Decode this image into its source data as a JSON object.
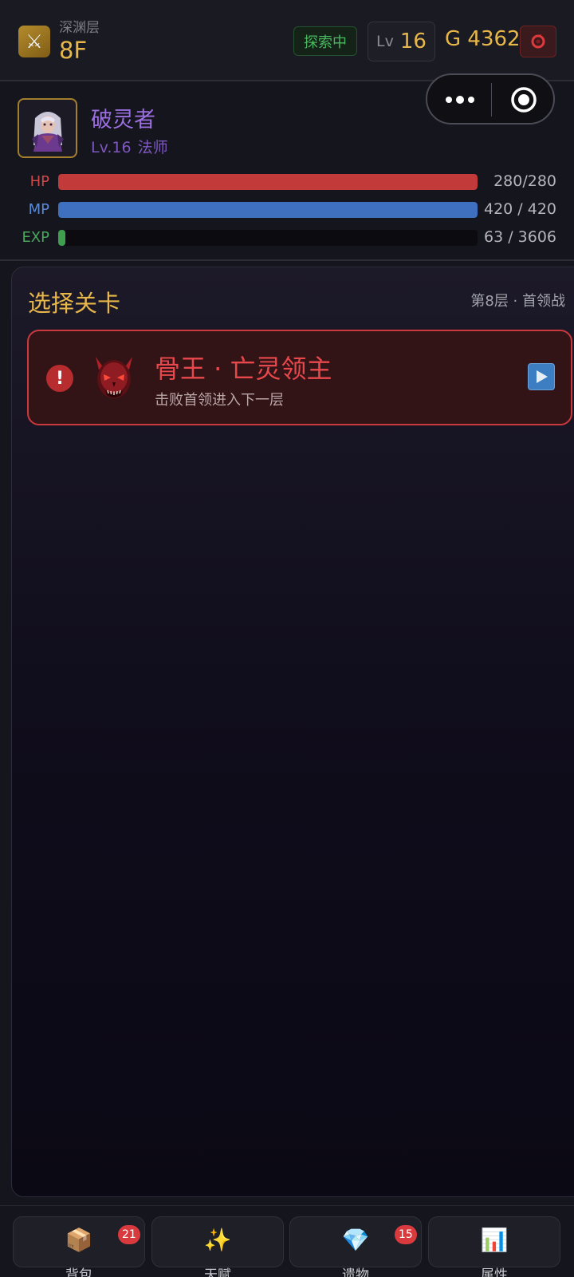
{
  "header": {
    "floor_label": "深渊层",
    "floor_value": "8F",
    "floor_icon": "crossed-swords-icon",
    "status": "探索中",
    "level_prefix": "Lv",
    "level": "16",
    "gold": "G 4362",
    "menu_icon": "red-swirl-icon"
  },
  "capsule": {
    "more_icon": "more-dots-icon",
    "close_icon": "target-circle-icon"
  },
  "player": {
    "name": "破灵者",
    "level_text": "Lv.16",
    "class_text": "法师",
    "name_color": "#9b6fe0",
    "stats": [
      {
        "label": "HP",
        "value": "280/280",
        "fill": 1.0,
        "color": "#c33a3a",
        "label_color": "#d04848"
      },
      {
        "label": "MP",
        "value": "420 / 420",
        "fill": 1.0,
        "color": "#3f6fbf",
        "label_color": "#5a8ad6"
      },
      {
        "label": "EXP",
        "value": "63 / 3606",
        "fill": 0.0175,
        "color": "#3ea04f",
        "label_color": "#4aa85d"
      }
    ]
  },
  "stage": {
    "title": "选择关卡",
    "meta": "第8层 · 首领战",
    "boss": {
      "alert": "!",
      "name": "骨王 · 亡灵领主",
      "desc": "击败首领进入下一层",
      "portrait": "demon-skull-icon",
      "action_icon": "play-triangle-icon"
    }
  },
  "nav": [
    {
      "label": "背包",
      "icon": "package-icon",
      "glyph": "📦",
      "badge": "21"
    },
    {
      "label": "天赋",
      "icon": "sparkles-icon",
      "glyph": "✨",
      "badge": ""
    },
    {
      "label": "遗物",
      "icon": "gem-icon",
      "glyph": "💎",
      "badge": "15"
    },
    {
      "label": "属性",
      "icon": "bar-chart-icon",
      "glyph": "📊",
      "badge": ""
    }
  ]
}
